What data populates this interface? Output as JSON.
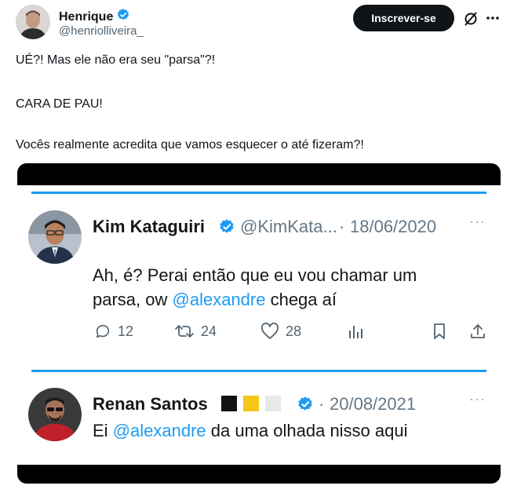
{
  "author": {
    "display_name": "Henrique",
    "handle": "@henriolliveira_",
    "subscribe_label": "Inscrever-se"
  },
  "tweet": {
    "line1": "UÉ?! Mas ele não era seu \"parsa\"?!",
    "line2": "CARA DE PAU!",
    "line3": "Vocês realmente acredita que vamos esquecer o até fizeram?!"
  },
  "embedded": {
    "tweet1": {
      "name": "Kim Kataguiri",
      "handle": "@KimKata...",
      "sep": "·",
      "date": "18/06/2020",
      "text_line1": "Ah, é? Perai então que eu vou chamar um",
      "text_line2_pre": "parsa, ow ",
      "mention": "@alexandre",
      "text_line2_post": " chega aí",
      "replies": "12",
      "retweets": "24",
      "likes": "28"
    },
    "tweet2": {
      "name": "Renan Santos",
      "sep": "·",
      "date": "20/08/2021",
      "text_pre": "Ei ",
      "mention": "@alexandre",
      "text_post": " da uma olhada nisso aqui"
    }
  },
  "colors": {
    "accent": "#1d9bf0",
    "verified": "#1d9bf0",
    "text": "#0f1419",
    "muted": "#536471"
  }
}
